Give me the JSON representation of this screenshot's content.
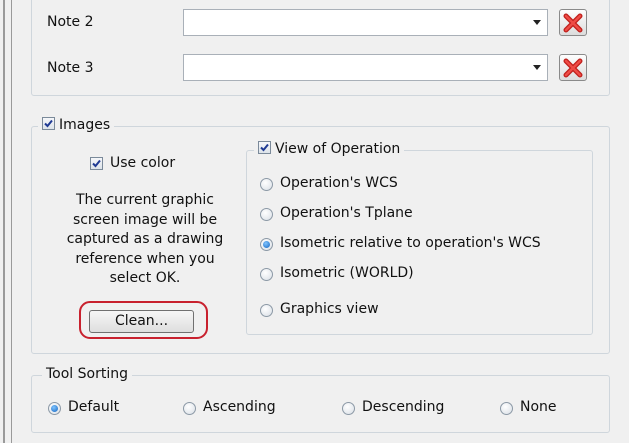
{
  "notes": [
    {
      "label": "Note 2",
      "value": ""
    },
    {
      "label": "Note 3",
      "value": ""
    }
  ],
  "images": {
    "label": "Images",
    "checked": true,
    "use_color_label": "Use color",
    "use_color_checked": true,
    "description_lines": [
      "The current graphic",
      "screen image will be",
      "captured as a drawing",
      "reference when you",
      "select OK."
    ],
    "clean_button": "Clean..."
  },
  "view_of_operation": {
    "label": "View of Operation",
    "checked": true,
    "options": [
      {
        "label": "Operation's WCS",
        "selected": false
      },
      {
        "label": "Operation's Tplane",
        "selected": false
      },
      {
        "label": "Isometric relative to operation's WCS",
        "selected": true
      },
      {
        "label": "Isometric (WORLD)",
        "selected": false
      },
      {
        "label": "Graphics view",
        "selected": false
      }
    ]
  },
  "tool_sorting": {
    "label": "Tool Sorting",
    "options": [
      {
        "label": "Default",
        "selected": true
      },
      {
        "label": "Ascending",
        "selected": false
      },
      {
        "label": "Descending",
        "selected": false
      },
      {
        "label": "None",
        "selected": false
      }
    ]
  },
  "colors": {
    "highlight": "#c8212e",
    "radio_selected": "#1565c0"
  }
}
